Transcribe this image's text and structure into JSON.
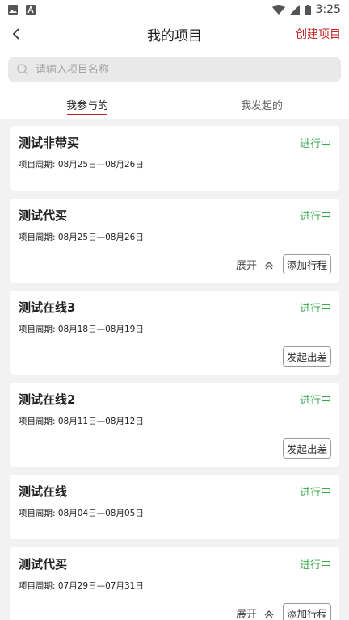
{
  "status_bar": {
    "time": "3:25"
  },
  "header": {
    "title": "我的项目",
    "create_label": "创建项目"
  },
  "search": {
    "placeholder": "请输入项目名称"
  },
  "tabs": [
    {
      "label": "我参与的",
      "active": true
    },
    {
      "label": "我发起的",
      "active": false
    }
  ],
  "projects": [
    {
      "name": "测试非带买",
      "status": "进行中",
      "period": "项目周期: 08月25日—08月26日"
    },
    {
      "name": "测试代买",
      "status": "进行中",
      "period": "项目周期: 08月25日—08月26日",
      "expand_label": "展开",
      "action_label": "添加行程"
    },
    {
      "name": "测试在线3",
      "status": "进行中",
      "period": "项目周期: 08月18日—08月19日",
      "action_label": "发起出差"
    },
    {
      "name": "测试在线2",
      "status": "进行中",
      "period": "项目周期: 08月11日—08月12日",
      "action_label": "发起出差"
    },
    {
      "name": "测试在线",
      "status": "进行中",
      "period": "项目周期: 08月04日—08月05日"
    },
    {
      "name": "测试代买",
      "status": "进行中",
      "period": "项目周期: 07月29日—07月31日",
      "expand_label": "展开",
      "action_label": "添加行程"
    }
  ],
  "colors": {
    "accent": "#c21f1f",
    "status": "#38a84b"
  }
}
